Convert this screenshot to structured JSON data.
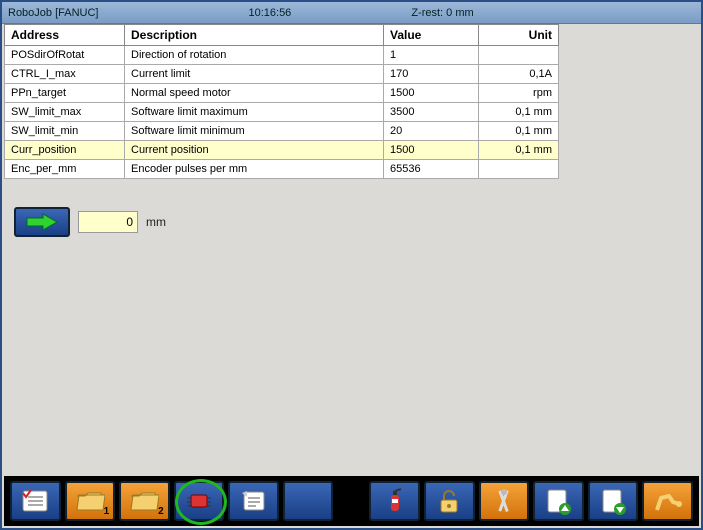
{
  "titlebar": {
    "app": "RoboJob [FANUC]",
    "time": "10:16:56",
    "zrest": "Z-rest: 0 mm"
  },
  "table": {
    "headers": {
      "address": "Address",
      "description": "Description",
      "value": "Value",
      "unit": "Unit"
    },
    "rows": [
      {
        "addr": "POSdirOfRotat",
        "desc": "Direction of rotation",
        "val": "1",
        "unit": "",
        "sel": false
      },
      {
        "addr": "CTRL_I_max",
        "desc": "Current limit",
        "val": "170",
        "unit": "0,1A",
        "sel": false
      },
      {
        "addr": "PPn_target",
        "desc": "Normal speed motor",
        "val": "1500",
        "unit": "rpm",
        "sel": false
      },
      {
        "addr": "SW_limit_max",
        "desc": "Software limit maximum",
        "val": "3500",
        "unit": "0,1 mm",
        "sel": false
      },
      {
        "addr": "SW_limit_min",
        "desc": "Software limit minimum",
        "val": "20",
        "unit": "0,1 mm",
        "sel": false
      },
      {
        "addr": "Curr_position",
        "desc": "Current position",
        "val": "1500",
        "unit": "0,1 mm",
        "sel": true
      },
      {
        "addr": "Enc_per_mm",
        "desc": "Encoder pulses per mm",
        "val": "65536",
        "unit": "",
        "sel": false
      }
    ]
  },
  "move": {
    "value": "0",
    "unit": "mm"
  },
  "toolbar": {
    "buttons": [
      {
        "name": "checklist-button",
        "icon": "checklist"
      },
      {
        "name": "folder1-button",
        "icon": "folder",
        "badge": "1",
        "orange": true
      },
      {
        "name": "folder2-button",
        "icon": "folder",
        "badge": "2",
        "orange": true
      },
      {
        "name": "chip-button",
        "icon": "chip",
        "circled": true
      },
      {
        "name": "notes-button",
        "icon": "notes"
      },
      {
        "name": "blank-button",
        "icon": "blank"
      },
      {
        "name": "extinguisher-button",
        "icon": "extinguisher"
      },
      {
        "name": "unlock-button",
        "icon": "unlock"
      },
      {
        "name": "tools-button",
        "icon": "tools",
        "orange": true
      },
      {
        "name": "page-up-button",
        "icon": "pageup"
      },
      {
        "name": "page-down-button",
        "icon": "pagedown"
      },
      {
        "name": "robot-button",
        "icon": "robot",
        "orange": true
      }
    ]
  }
}
